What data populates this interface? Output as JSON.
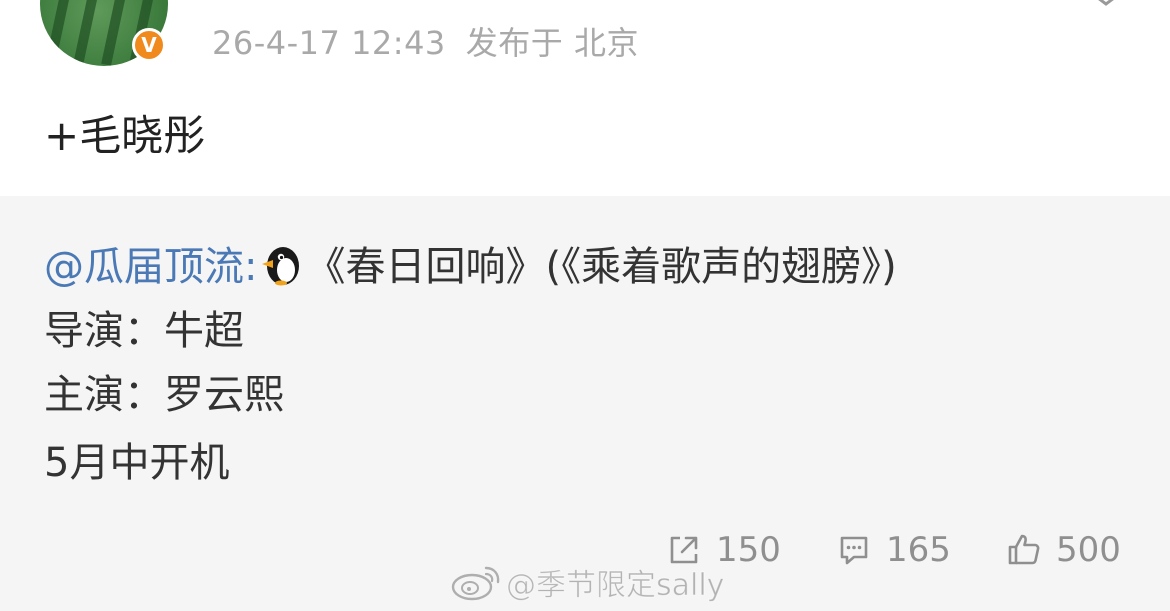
{
  "post": {
    "timestamp": "26-4-17 12:43",
    "location": "发布于 北京",
    "text": "+毛晓彤",
    "verified_badge": "V"
  },
  "repost": {
    "author": "@瓜届顶流",
    "author_suffix": ":",
    "line1_rest": "《春日回响》(《乘着歌声的翅膀》)",
    "line2": "导演：牛超",
    "line3": "主演：罗云熙",
    "line4": "5月中开机"
  },
  "actions": {
    "share_count": "150",
    "comment_count": "165",
    "like_count": "500"
  },
  "watermark": {
    "text": "@季节限定sally"
  },
  "colors": {
    "link": "#4a79b6",
    "meta": "#a9a9a9",
    "repost_bg": "#f5f5f5",
    "verified": "#f08a1c"
  }
}
